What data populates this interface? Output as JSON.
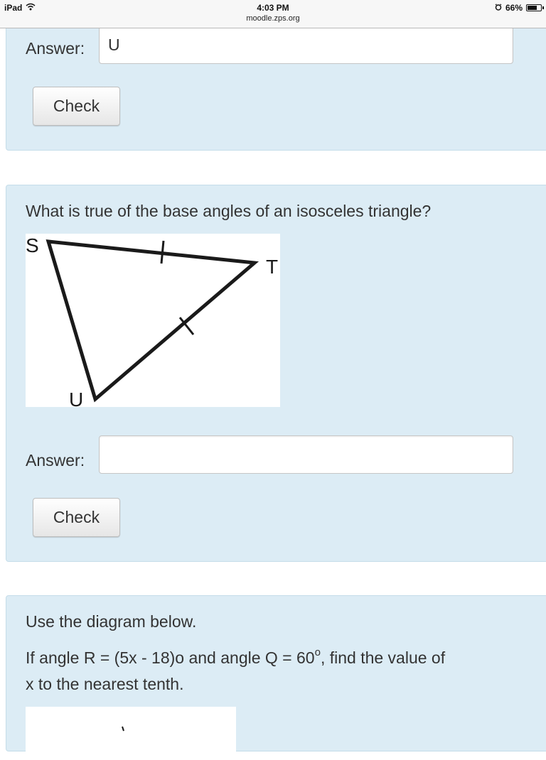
{
  "status_bar": {
    "device": "iPad",
    "time": "4:03 PM",
    "url": "moodle.zps.org",
    "battery": "66%",
    "battery_level": 0.66,
    "icons": [
      "wifi-icon",
      "alarm-icon",
      "battery-icon"
    ]
  },
  "question1": {
    "answer_label": "Answer:",
    "answer_value": "U",
    "check_label": "Check"
  },
  "question2": {
    "prompt": "What is true of the base angles of an isosceles triangle?",
    "diagram_labels": {
      "s": "S",
      "t": "T",
      "u": "U"
    },
    "answer_label": "Answer:",
    "answer_value": "",
    "check_label": "Check"
  },
  "question3": {
    "line1": "Use the diagram below.",
    "line2_part1": "If angle R = (5x - 18)o  and angle Q = 60",
    "line2_sup": "o",
    "line2_part2": ", find the value of",
    "line3": "x to the nearest tenth."
  },
  "colors": {
    "card_background": "#dcecf5",
    "card_border": "#c5dde9",
    "text": "#333333"
  }
}
